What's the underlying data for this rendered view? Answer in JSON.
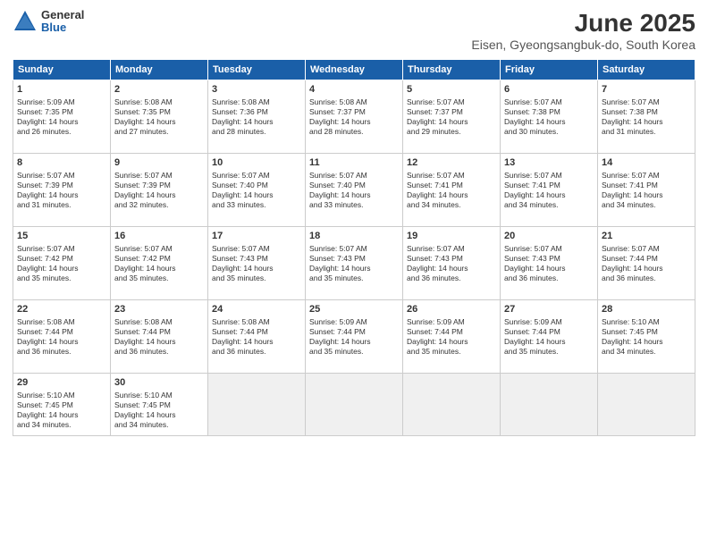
{
  "logo": {
    "general": "General",
    "blue": "Blue"
  },
  "title": "June 2025",
  "subtitle": "Eisen, Gyeongsangbuk-do, South Korea",
  "headers": [
    "Sunday",
    "Monday",
    "Tuesday",
    "Wednesday",
    "Thursday",
    "Friday",
    "Saturday"
  ],
  "weeks": [
    [
      {
        "day": "1",
        "detail": "Sunrise: 5:09 AM\nSunset: 7:35 PM\nDaylight: 14 hours\nand 26 minutes."
      },
      {
        "day": "2",
        "detail": "Sunrise: 5:08 AM\nSunset: 7:35 PM\nDaylight: 14 hours\nand 27 minutes."
      },
      {
        "day": "3",
        "detail": "Sunrise: 5:08 AM\nSunset: 7:36 PM\nDaylight: 14 hours\nand 28 minutes."
      },
      {
        "day": "4",
        "detail": "Sunrise: 5:08 AM\nSunset: 7:37 PM\nDaylight: 14 hours\nand 28 minutes."
      },
      {
        "day": "5",
        "detail": "Sunrise: 5:07 AM\nSunset: 7:37 PM\nDaylight: 14 hours\nand 29 minutes."
      },
      {
        "day": "6",
        "detail": "Sunrise: 5:07 AM\nSunset: 7:38 PM\nDaylight: 14 hours\nand 30 minutes."
      },
      {
        "day": "7",
        "detail": "Sunrise: 5:07 AM\nSunset: 7:38 PM\nDaylight: 14 hours\nand 31 minutes."
      }
    ],
    [
      {
        "day": "8",
        "detail": "Sunrise: 5:07 AM\nSunset: 7:39 PM\nDaylight: 14 hours\nand 31 minutes."
      },
      {
        "day": "9",
        "detail": "Sunrise: 5:07 AM\nSunset: 7:39 PM\nDaylight: 14 hours\nand 32 minutes."
      },
      {
        "day": "10",
        "detail": "Sunrise: 5:07 AM\nSunset: 7:40 PM\nDaylight: 14 hours\nand 33 minutes."
      },
      {
        "day": "11",
        "detail": "Sunrise: 5:07 AM\nSunset: 7:40 PM\nDaylight: 14 hours\nand 33 minutes."
      },
      {
        "day": "12",
        "detail": "Sunrise: 5:07 AM\nSunset: 7:41 PM\nDaylight: 14 hours\nand 34 minutes."
      },
      {
        "day": "13",
        "detail": "Sunrise: 5:07 AM\nSunset: 7:41 PM\nDaylight: 14 hours\nand 34 minutes."
      },
      {
        "day": "14",
        "detail": "Sunrise: 5:07 AM\nSunset: 7:41 PM\nDaylight: 14 hours\nand 34 minutes."
      }
    ],
    [
      {
        "day": "15",
        "detail": "Sunrise: 5:07 AM\nSunset: 7:42 PM\nDaylight: 14 hours\nand 35 minutes."
      },
      {
        "day": "16",
        "detail": "Sunrise: 5:07 AM\nSunset: 7:42 PM\nDaylight: 14 hours\nand 35 minutes."
      },
      {
        "day": "17",
        "detail": "Sunrise: 5:07 AM\nSunset: 7:43 PM\nDaylight: 14 hours\nand 35 minutes."
      },
      {
        "day": "18",
        "detail": "Sunrise: 5:07 AM\nSunset: 7:43 PM\nDaylight: 14 hours\nand 35 minutes."
      },
      {
        "day": "19",
        "detail": "Sunrise: 5:07 AM\nSunset: 7:43 PM\nDaylight: 14 hours\nand 36 minutes."
      },
      {
        "day": "20",
        "detail": "Sunrise: 5:07 AM\nSunset: 7:43 PM\nDaylight: 14 hours\nand 36 minutes."
      },
      {
        "day": "21",
        "detail": "Sunrise: 5:07 AM\nSunset: 7:44 PM\nDaylight: 14 hours\nand 36 minutes."
      }
    ],
    [
      {
        "day": "22",
        "detail": "Sunrise: 5:08 AM\nSunset: 7:44 PM\nDaylight: 14 hours\nand 36 minutes."
      },
      {
        "day": "23",
        "detail": "Sunrise: 5:08 AM\nSunset: 7:44 PM\nDaylight: 14 hours\nand 36 minutes."
      },
      {
        "day": "24",
        "detail": "Sunrise: 5:08 AM\nSunset: 7:44 PM\nDaylight: 14 hours\nand 36 minutes."
      },
      {
        "day": "25",
        "detail": "Sunrise: 5:09 AM\nSunset: 7:44 PM\nDaylight: 14 hours\nand 35 minutes."
      },
      {
        "day": "26",
        "detail": "Sunrise: 5:09 AM\nSunset: 7:44 PM\nDaylight: 14 hours\nand 35 minutes."
      },
      {
        "day": "27",
        "detail": "Sunrise: 5:09 AM\nSunset: 7:44 PM\nDaylight: 14 hours\nand 35 minutes."
      },
      {
        "day": "28",
        "detail": "Sunrise: 5:10 AM\nSunset: 7:45 PM\nDaylight: 14 hours\nand 34 minutes."
      }
    ],
    [
      {
        "day": "29",
        "detail": "Sunrise: 5:10 AM\nSunset: 7:45 PM\nDaylight: 14 hours\nand 34 minutes."
      },
      {
        "day": "30",
        "detail": "Sunrise: 5:10 AM\nSunset: 7:45 PM\nDaylight: 14 hours\nand 34 minutes."
      },
      {
        "day": "",
        "detail": ""
      },
      {
        "day": "",
        "detail": ""
      },
      {
        "day": "",
        "detail": ""
      },
      {
        "day": "",
        "detail": ""
      },
      {
        "day": "",
        "detail": ""
      }
    ]
  ]
}
